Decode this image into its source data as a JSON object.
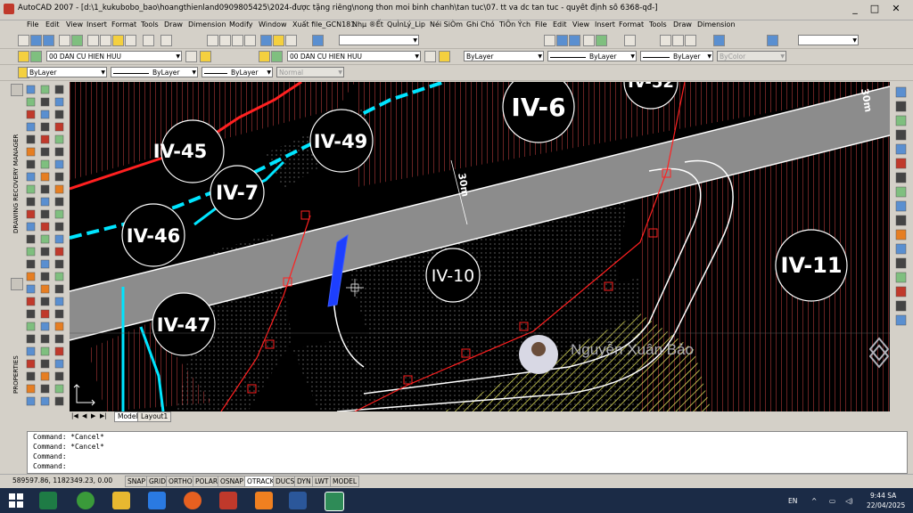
{
  "window": {
    "title": "AutoCAD 2007 - [d:\\1_kukubobo_bao\\hoangthienland0909805425\\2024-được tặng riêng\\nong thon moi binh chanh\\tan tuc\\07. tt va dc tan tuc - quyết định số 6368-qđ-]",
    "controls": [
      "_",
      "□",
      "✕"
    ]
  },
  "menu": [
    "File",
    "Edit",
    "View",
    "Insert",
    "Format",
    "Tools",
    "Draw",
    "Dimension",
    "Modify",
    "Window",
    "Xuất file_GCN181",
    "Nhµ ®Ết",
    "QuÌnLý_Lip",
    "Néi SiÒm",
    "Ghi Chó",
    "TiÖn Ých",
    "File",
    "Edit",
    "View",
    "Insert",
    "Format",
    "Tools",
    "Draw",
    "Dimension"
  ],
  "layers": {
    "layer_combo_left": "00 DAN CU HIEN HUU",
    "layer_combo_right": "00 DAN CU HIEN HUU",
    "bylayer_color": "ByLayer",
    "bylayer_linetype": "ByLayer",
    "bylayer_lineweight": "ByLayer",
    "plot_style": "Normal",
    "bylayer_color_2": "ByLayer",
    "bylayer_linetype_2": "ByLayer",
    "bylayer_lineweight_2": "ByLayer",
    "bycolor": "ByColor"
  },
  "side_panels": {
    "recovery": "DRAWING RECOVERY MANAGER",
    "properties": "PROPERTIES"
  },
  "drawing": {
    "parcels": [
      "IV-6",
      "IV-45",
      "IV-49",
      "IV-7",
      "IV-46",
      "IV-10",
      "IV-11",
      "IV-47",
      "IV-52"
    ],
    "road_width_labels": [
      "30m",
      "30m"
    ],
    "watermark_name": "Nguyễn Xuân Bảo"
  },
  "layout_tabs": [
    "Model",
    "Layout1"
  ],
  "command_lines": [
    "Command: *Cancel*",
    "Command: *Cancel*",
    "Command:",
    "Command:"
  ],
  "status": {
    "coords": "589597.86, 1182349.23, 0.00",
    "toggles": [
      "SNAP",
      "GRID",
      "ORTHO",
      "POLAR",
      "OSNAP",
      "OTRACK",
      "DUCS",
      "DYN",
      "LWT",
      "MODEL"
    ]
  },
  "taskbar": {
    "lang": "EN",
    "time": "9:44 SA",
    "date": "22/04/2025"
  },
  "colors": {
    "road": "#8c8c8c",
    "parcel_line": "#ffffff",
    "hatch": "#e06060",
    "boundary_red": "#ff2020",
    "boundary_cyan": "#00e5ff",
    "hatch_yellow": "#e8e860"
  }
}
